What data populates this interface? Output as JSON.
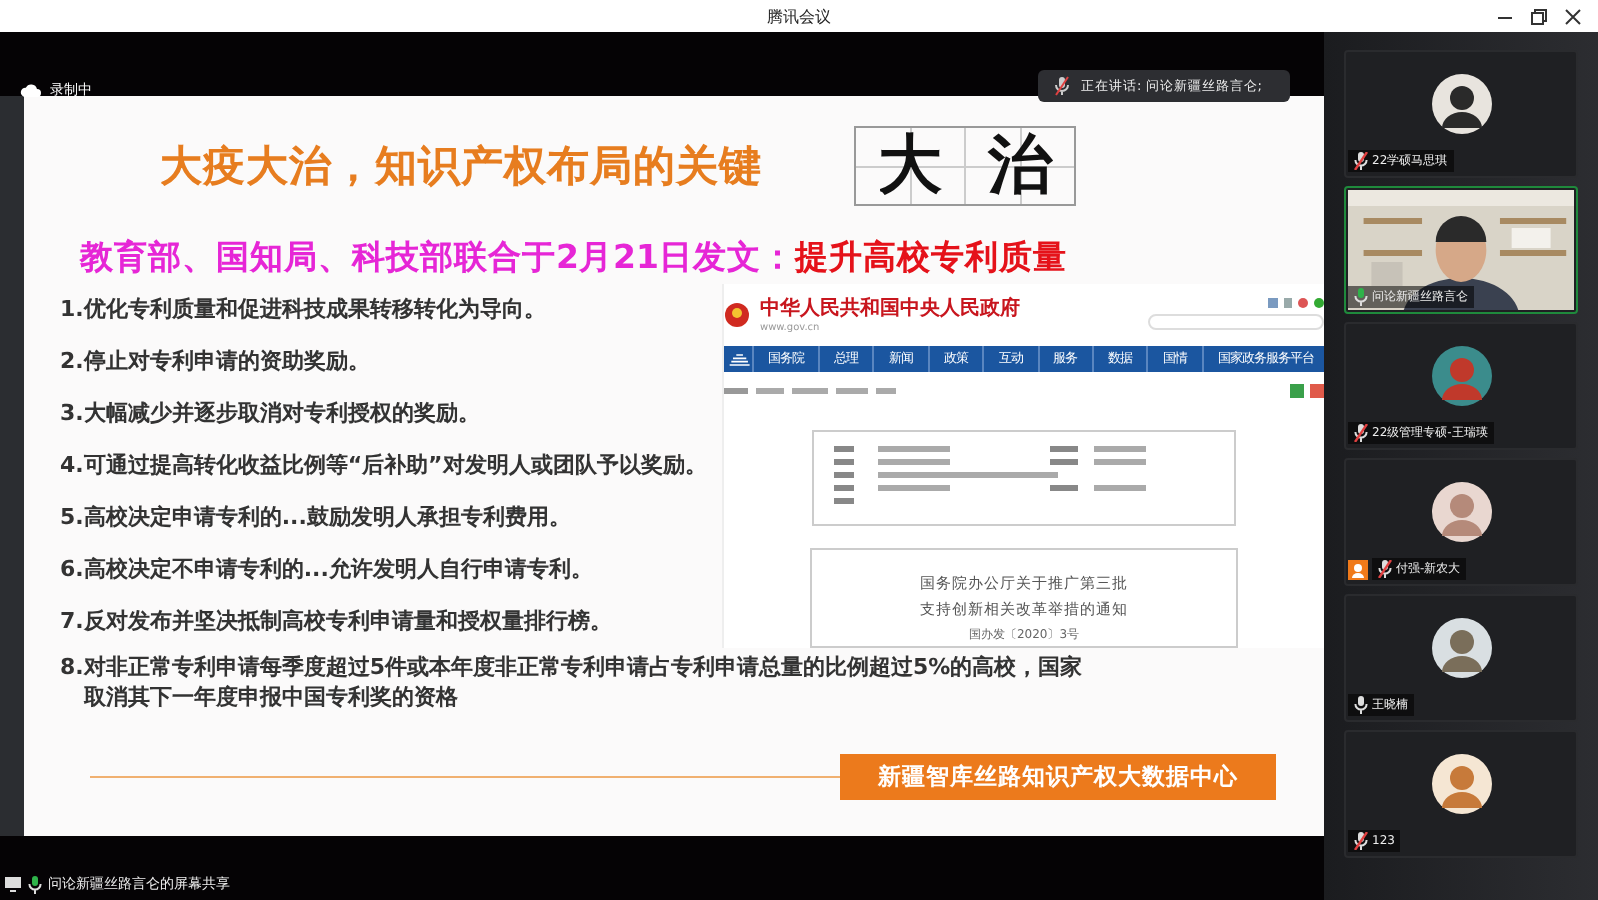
{
  "window": {
    "title": "腾讯会议"
  },
  "recording": {
    "label": "录制中"
  },
  "speaker": {
    "text": "正在讲话: 问论新疆丝路言仑;"
  },
  "slide": {
    "title": "大疫大治，知识产权布局的关键",
    "calligraphy": [
      "大",
      "治"
    ],
    "subtitle": {
      "lead": "教育部、国知局、科技部联合于2月21日发文：",
      "emphasis": "提升高校专利质量"
    },
    "points": [
      "1.优化专利质量和促进科技成果转移转化为导向。",
      "2.停止对专利申请的资助奖励。",
      "3.大幅减少并逐步取消对专利授权的奖励。",
      "4.可通过提高转化收益比例等“后补助”对发明人或团队予以奖励。",
      "5.高校决定申请专利的...鼓励发明人承担专利费用。",
      "6.高校决定不申请专利的...允许发明人自行申请专利。",
      "7.反对发布并坚决抵制高校专利申请量和授权量排行榜。",
      "8.对非正常专利申请每季度超过5件或本年度非正常专利申请占专利申请总量的比例超过5%的高校，国家取消其下一年度申报中国专利奖的资格"
    ],
    "web": {
      "site_title": "中华人民共和国中央人民政府",
      "url": "www.gov.cn",
      "nav": [
        "国务院",
        "总理",
        "新闻",
        "政策",
        "互动",
        "服务",
        "数据",
        "国情",
        "国家政务服务平台"
      ],
      "doc_title": [
        "国务院办公厅关于推广第三批",
        "支持创新相关改革举措的通知"
      ],
      "doc_number": "国办发〔2020〕3号"
    },
    "footer": "新疆智库丝路知识产权大数据中心"
  },
  "participants": [
    {
      "name": "22学硕马思琪",
      "kind": "avatar",
      "muted": true,
      "speaking": false,
      "host_badge": false
    },
    {
      "name": "问论新疆丝路言仑",
      "kind": "video",
      "muted": false,
      "speaking": true,
      "host_badge": false
    },
    {
      "name": "22级管理专硕-王瑞瑛",
      "kind": "avatar",
      "muted": true,
      "speaking": false,
      "host_badge": false
    },
    {
      "name": "付强-新农大",
      "kind": "avatar",
      "muted": true,
      "speaking": false,
      "host_badge": true
    },
    {
      "name": "王晓楠",
      "kind": "avatar",
      "muted": false,
      "speaking": false,
      "host_badge": false
    },
    {
      "name": "123",
      "kind": "avatar",
      "muted": true,
      "speaking": false,
      "host_badge": false
    }
  ],
  "status": {
    "text": "问论新疆丝路言仑的屏幕共享"
  }
}
